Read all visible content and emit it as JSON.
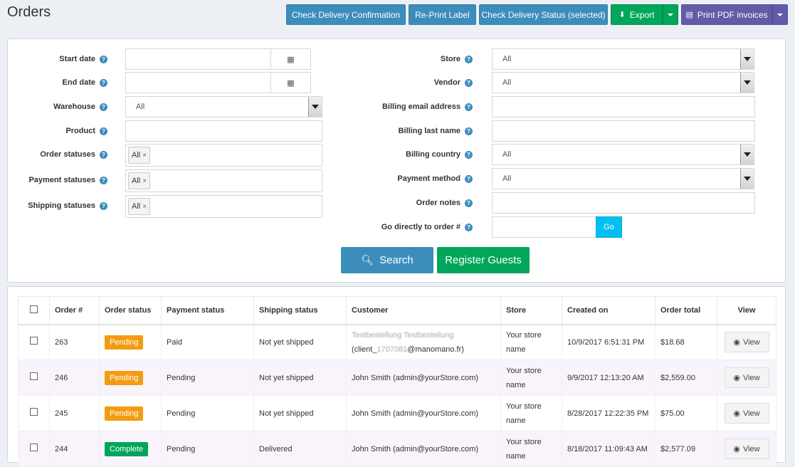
{
  "page": {
    "title": "Orders"
  },
  "toolbar": {
    "check_delivery_confirmation": "Check Delivery Confirmation",
    "reprint_label": "Re-Print Label",
    "check_delivery_status": "Check Delivery Status (selected)",
    "export": "Export",
    "print_pdf": "Print PDF invoices"
  },
  "search": {
    "left": {
      "start_date": "Start date",
      "end_date": "End date",
      "warehouse": "Warehouse",
      "warehouse_value": "All",
      "product": "Product",
      "order_statuses": "Order statuses",
      "payment_statuses": "Payment statuses",
      "shipping_statuses": "Shipping statuses",
      "chip": "All"
    },
    "right": {
      "store": "Store",
      "store_value": "All",
      "vendor": "Vendor",
      "vendor_value": "All",
      "billing_email": "Billing email address",
      "billing_last_name": "Billing last name",
      "billing_country": "Billing country",
      "billing_country_value": "All",
      "payment_method": "Payment method",
      "payment_method_value": "All",
      "order_notes": "Order notes",
      "go_to_order": "Go directly to order #",
      "go_button": "Go"
    },
    "search_button": "Search",
    "register_guests_button": "Register Guests"
  },
  "grid": {
    "headers": [
      "Order #",
      "Order status",
      "Payment status",
      "Shipping status",
      "Customer",
      "Store",
      "Created on",
      "Order total",
      "View"
    ],
    "rows": [
      {
        "id": "263",
        "status": "Pending",
        "payment": "Paid",
        "shipping": "Not yet shipped",
        "customer_line1": "Testbestellung Testbestellung",
        "customer_line2_prefix": "(client_",
        "customer_line2_hidden": "1707081",
        "customer_line2_suffix": "@manomano.fr)",
        "store": "Your store name",
        "created": "10/9/2017 6:51:31 PM",
        "total": "$18.68",
        "view": "View"
      },
      {
        "id": "246",
        "status": "Pending",
        "payment": "Pending",
        "shipping": "Not yet shipped",
        "customer": "John Smith (admin@yourStore.com)",
        "store": "Your store name",
        "created": "9/9/2017 12:13:20 AM",
        "total": "$2,559.00",
        "view": "View"
      },
      {
        "id": "245",
        "status": "Pending",
        "payment": "Pending",
        "shipping": "Not yet shipped",
        "customer": "John Smith (admin@yourStore.com)",
        "store": "Your store name",
        "created": "8/28/2017 12:22:35 PM",
        "total": "$75.00",
        "view": "View"
      },
      {
        "id": "244",
        "status": "Complete",
        "payment": "Pending",
        "shipping": "Delivered",
        "customer": "John Smith (admin@yourStore.com)",
        "store": "Your store name",
        "created": "8/18/2017 11:09:43 AM",
        "total": "$2,577.09",
        "view": "View"
      }
    ]
  },
  "colors": {
    "primary": "#3c8dbc",
    "success": "#00a65a",
    "purple": "#605ca8",
    "warning": "#f39c12",
    "info": "#00c0ef"
  }
}
